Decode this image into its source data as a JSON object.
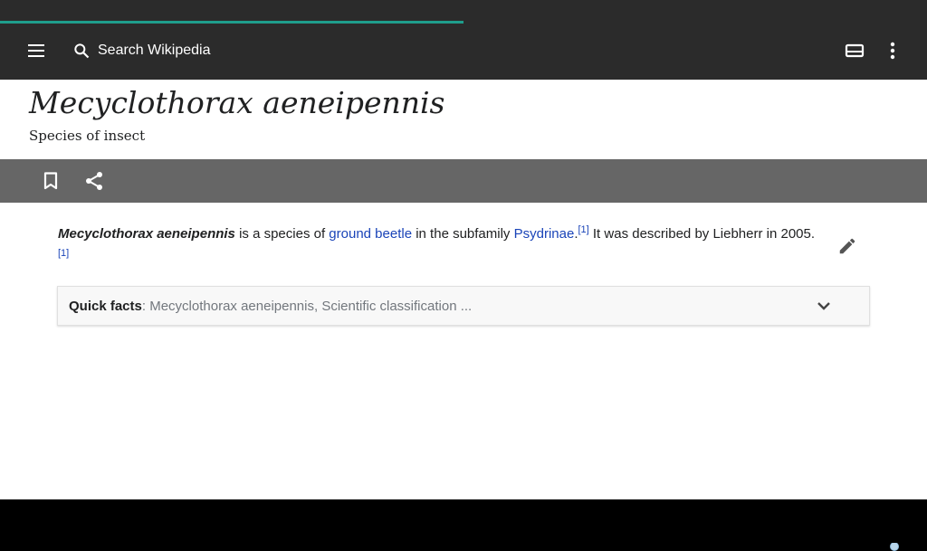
{
  "loading_progress_percent": 50,
  "toolbar": {
    "menu_icon": "menu-icon",
    "search_icon": "search-icon",
    "search_placeholder": "Search Wikipedia",
    "reading_list_icon": "reading-list-icon",
    "overflow_icon": "overflow-menu-icon"
  },
  "article": {
    "title": "Mecyclothorax aeneipennis",
    "description": "Species of insect",
    "paragraph": {
      "bold_name": "Mecyclothorax aeneipennis",
      "text1": " is a species of ",
      "link1": "ground beetle",
      "text2": " in the subfamily ",
      "link2": "Psydrinae",
      "text3": ".",
      "ref1": "[1]",
      "text4": " It was described by Liebherr in 2005.",
      "ref2": "[1]"
    },
    "quick_facts": {
      "label": "Quick facts",
      "summary": ": Mecyclothorax aeneipennis, Scientific classification ..."
    }
  },
  "colors": {
    "link": "#1a44b8",
    "toolbar": "#2b2b2b",
    "action_bar": "#666666",
    "progress": "#1f9e8c"
  }
}
